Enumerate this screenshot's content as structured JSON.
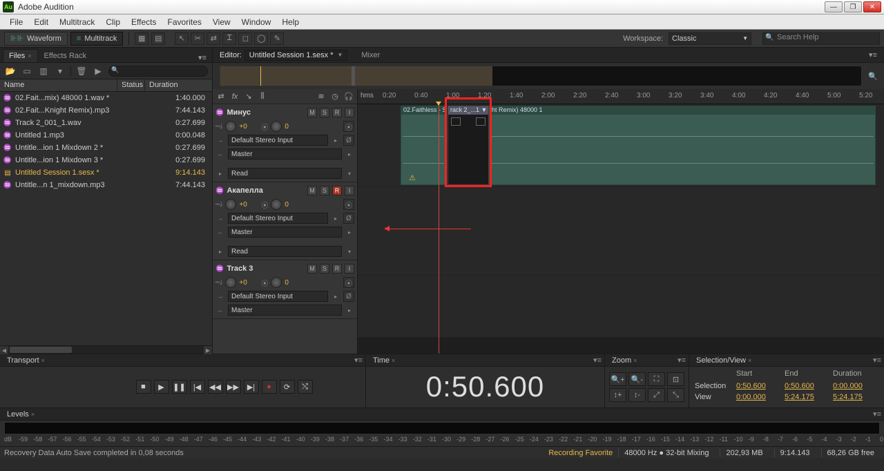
{
  "app": {
    "title": "Adobe Audition",
    "logo": "Au"
  },
  "menu": [
    "File",
    "Edit",
    "Multitrack",
    "Clip",
    "Effects",
    "Favorites",
    "View",
    "Window",
    "Help"
  ],
  "modes": {
    "waveform": "Waveform",
    "multitrack": "Multitrack"
  },
  "workspace": {
    "label": "Workspace:",
    "value": "Classic"
  },
  "search": {
    "placeholder": "Search Help"
  },
  "panels": {
    "files_tab": "Files",
    "effects_tab": "Effects Rack",
    "editor_label": "Editor:",
    "editor_file": "Untitled Session 1.sesx *",
    "mixer_tab": "Mixer",
    "transport": "Transport",
    "time": "Time",
    "zoom": "Zoom",
    "selview": "Selection/View",
    "levels": "Levels"
  },
  "files_header": {
    "name": "Name",
    "status": "Status",
    "duration": "Duration"
  },
  "files": [
    {
      "icon": "wave",
      "name": "02.Fait...mix) 48000 1.wav *",
      "dur": "1:40.000"
    },
    {
      "icon": "wave",
      "name": "02.Fait...Knight Remix).mp3",
      "dur": "7:44.143"
    },
    {
      "icon": "wave",
      "name": "Track 2_001_1.wav",
      "dur": "0:27.699"
    },
    {
      "icon": "wave",
      "name": "Untitled 1.mp3",
      "dur": "0:00.048"
    },
    {
      "icon": "wave",
      "name": "Untitle...ion 1 Mixdown 2 *",
      "dur": "0:27.699"
    },
    {
      "icon": "wave",
      "name": "Untitle...ion 1 Mixdown 3 *",
      "dur": "0:27.699"
    },
    {
      "icon": "sess",
      "name": "Untitled Session 1.sesx *",
      "dur": "9:14.143",
      "sel": true
    },
    {
      "icon": "wave",
      "name": "Untitle...n 1_mixdown.mp3",
      "dur": "7:44.143"
    }
  ],
  "ruler": {
    "hms": "hms",
    "ticks": [
      "0:20",
      "0:40",
      "1:00",
      "1:20",
      "1:40",
      "2:00",
      "2:20",
      "2:40",
      "3:00",
      "3:20",
      "3:40",
      "4:00",
      "4:20",
      "4:40",
      "5:00",
      "5:20"
    ]
  },
  "tracks": [
    {
      "name": "Минус",
      "vol": "+0",
      "pan": "0",
      "input": "Default Stereo Input",
      "output": "Master",
      "mode": "Read",
      "m": false,
      "s": false,
      "r": false
    },
    {
      "name": "Акапелла",
      "vol": "+0",
      "pan": "0",
      "input": "Default Stereo Input",
      "output": "Master",
      "mode": "Read",
      "m": false,
      "s": false,
      "r": true
    },
    {
      "name": "Track 3",
      "vol": "+0",
      "pan": "0",
      "input": "Default Stereo Input",
      "output": "Master",
      "m": false,
      "s": false,
      "r": false
    }
  ],
  "clips": {
    "main": "02.Faithless - Sun",
    "sel": "rack 2_...1 ▼",
    "right": "ht Remix) 48000 1"
  },
  "timecode": "0:50.600",
  "selview_data": {
    "hdr": {
      "start": "Start",
      "end": "End",
      "dur": "Duration"
    },
    "selection": {
      "label": "Selection",
      "start": "0:50.600",
      "end": "0:50.600",
      "dur": "0:00.000"
    },
    "view": {
      "label": "View",
      "start": "0:00.000",
      "end": "5:24.175",
      "dur": "5:24.175"
    }
  },
  "status": {
    "msg": "Recovery Data Auto Save completed in 0,08 seconds",
    "rec": "Recording Favorite",
    "rate": "48000 Hz ● 32-bit Mixing",
    "mem": "202,93 MB",
    "dur": "9:14.143",
    "disk": "68,26 GB free"
  },
  "db_ticks": [
    "dB",
    "-59",
    "-58",
    "-57",
    "-56",
    "-55",
    "-54",
    "-53",
    "-52",
    "-51",
    "-50",
    "-49",
    "-48",
    "-47",
    "-46",
    "-45",
    "-44",
    "-43",
    "-42",
    "-41",
    "-40",
    "-39",
    "-38",
    "-37",
    "-36",
    "-35",
    "-34",
    "-33",
    "-32",
    "-31",
    "-30",
    "-29",
    "-28",
    "-27",
    "-26",
    "-25",
    "-24",
    "-23",
    "-22",
    "-21",
    "-20",
    "-19",
    "-18",
    "-17",
    "-16",
    "-15",
    "-14",
    "-13",
    "-12",
    "-11",
    "-10",
    "-9",
    "-8",
    "-7",
    "-6",
    "-5",
    "-4",
    "-3",
    "-2",
    "-1",
    "0"
  ]
}
